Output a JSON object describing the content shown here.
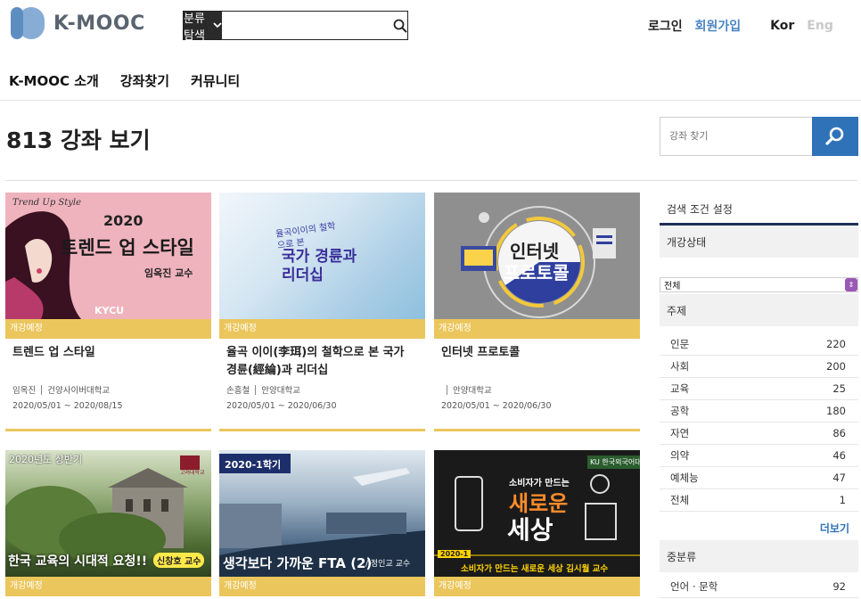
{
  "header": {
    "logo_text": "K-MOOC",
    "category_button": "분류 탐색",
    "login": "로그인",
    "signup": "회원가입",
    "lang_kor": "Kor",
    "lang_eng": "Eng"
  },
  "nav": {
    "items": [
      "K-MOOC 소개",
      "강좌찾기",
      "커뮤니티"
    ]
  },
  "page": {
    "title": "813 강좌 보기",
    "search_placeholder": "강좌 찾기"
  },
  "courses": [
    {
      "thumb_top": "Trend Up Style",
      "thumb_year": "2020",
      "thumb_title": "트렌드 업 스타일",
      "thumb_prof": "임옥진 교수",
      "thumb_org": "KYCU",
      "status": "개강예정",
      "title": "트렌드 업 스타일",
      "instructor": "임옥진",
      "university": "건양사이버대학교",
      "dates": "2020/05/01 ~ 2020/08/15"
    },
    {
      "thumb_small": "율곡이이의 철학으로 본",
      "thumb_title": "국가 경륜과 리더십",
      "status": "개강예정",
      "title": "율곡 이이(李珥)의 철학으로 본 국가 경륜(經綸)과 리더십",
      "instructor": "손흥철",
      "university": "안양대학교",
      "dates": "2020/05/01 ~ 2020/06/30"
    },
    {
      "thumb_title1": "인터넷",
      "thumb_title2": "프로토콜",
      "status": "개강예정",
      "title": "인터넷 프로토콜",
      "instructor": "",
      "university": "안양대학교",
      "dates": "2020/05/01 ~ 2020/06/30"
    },
    {
      "thumb_top": "2020년도 상반기",
      "thumb_logo": "고려대학교",
      "thumb_title": "한국 교육의 시대적 요청!!",
      "thumb_prof": "신창호 교수",
      "status": "개강예정"
    },
    {
      "thumb_top": "2020-1학기",
      "thumb_title": "생각보다 가까운 FTA (2)",
      "thumb_prof": "/ 정인교 교수",
      "status": "개강예정"
    },
    {
      "thumb_ku": "KU 한국외국어대학",
      "thumb_small": "소비자가 만드는",
      "thumb_big1": "새로운",
      "thumb_big2": "세상",
      "thumb_year": "2020-1",
      "thumb_bottom": "소비자가 만드는 새로운 세상 김시월 교수",
      "status": "개강예정"
    }
  ],
  "sidebar": {
    "heading": "검색 조건 설정",
    "status_section": "개강상태",
    "status_value": "전체",
    "subject_section": "주제",
    "subjects": [
      {
        "name": "인문",
        "count": "220"
      },
      {
        "name": "사회",
        "count": "200"
      },
      {
        "name": "교육",
        "count": "25"
      },
      {
        "name": "공학",
        "count": "180"
      },
      {
        "name": "자연",
        "count": "86"
      },
      {
        "name": "의약",
        "count": "46"
      },
      {
        "name": "예체능",
        "count": "47"
      },
      {
        "name": "전체",
        "count": "1"
      }
    ],
    "more": "더보기",
    "mid_section": "중분류",
    "mid_items": [
      {
        "name": "언어 · 문학",
        "count": "92"
      }
    ]
  },
  "colors": {
    "accent": "#2f72b8",
    "badge": "#ebc65c",
    "brand": "#5d8ec2"
  }
}
